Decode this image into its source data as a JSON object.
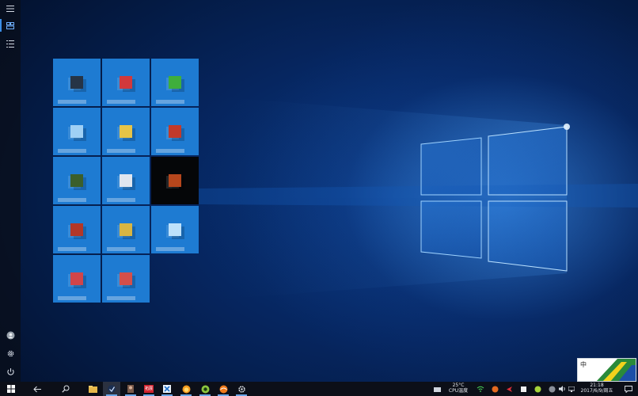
{
  "rail": {
    "items": [
      "menu-icon",
      "tiles-icon",
      "list-icon"
    ],
    "bottom": [
      "user-icon",
      "settings-icon",
      "power-icon"
    ]
  },
  "tiles": [
    {
      "id": "t1",
      "color": "#1e7bd2",
      "glyph_color": "#263446"
    },
    {
      "id": "t2",
      "color": "#1e7bd2",
      "glyph_color": "#d2393c"
    },
    {
      "id": "t3",
      "color": "#1e7bd2",
      "glyph_color": "#3fae3c"
    },
    {
      "id": "t4",
      "color": "#1e7bd2",
      "glyph_color": "#9fd0f5"
    },
    {
      "id": "t5",
      "color": "#1e7bd2",
      "glyph_color": "#e7c447"
    },
    {
      "id": "t6",
      "color": "#1e7bd2",
      "glyph_color": "#c23a2a"
    },
    {
      "id": "t7",
      "color": "#1e7bd2",
      "glyph_color": "#3b5f2b"
    },
    {
      "id": "t8",
      "color": "#1e7bd2",
      "glyph_color": "#e0e6ef"
    },
    {
      "id": "t9",
      "color": "#050608",
      "glyph_color": "#b6461c"
    },
    {
      "id": "t10",
      "color": "#1e7bd2",
      "glyph_color": "#b33727"
    },
    {
      "id": "t11",
      "color": "#1e7bd2",
      "glyph_color": "#d8b542"
    },
    {
      "id": "t12",
      "color": "#1e7bd2",
      "glyph_color": "#bde1fb"
    },
    {
      "id": "t13",
      "color": "#1e7bd2",
      "glyph_color": "#d0454a"
    },
    {
      "id": "t14",
      "color": "#1e7bd2",
      "glyph_color": "#d34f4a"
    }
  ],
  "taskbar": {
    "pinned_label": "拓展",
    "icons": [
      "windows-icon",
      "back-arrow-icon",
      "search-icon",
      "file-explorer-icon",
      "steam-icon",
      "person-icon",
      "red-app-icon",
      "blue-app-icon",
      "firefox-like-icon",
      "green-ball-icon",
      "orange-ball-icon",
      "settings-gear-icon"
    ],
    "temperature": "25°C",
    "cpu_label": "CPU温度",
    "time": "21:18",
    "date": "2017/6/9/周五"
  },
  "sticker": {
    "text_left": "中"
  },
  "colors": {
    "accent": "#3b8ee6",
    "tile_blue": "#1e7bd2"
  }
}
